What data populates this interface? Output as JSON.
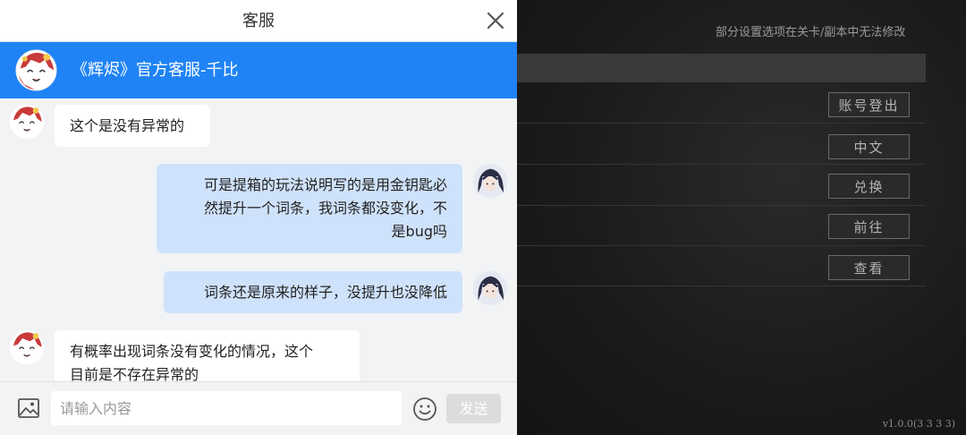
{
  "game": {
    "note": "部分设置选项在关卡/副本中无法修改",
    "buttons": [
      "账号登出",
      "中文",
      "兑换",
      "前往",
      "查看"
    ],
    "version": "v1.0.0(3 3 3 3)"
  },
  "chat": {
    "window_title": "客服",
    "agent_name": "《辉烬》官方客服-千比",
    "messages": [
      {
        "from": "agent",
        "text": "这个是没有异常的"
      },
      {
        "from": "user",
        "lines": [
          "可是提箱的玩法说明写的是用金钥匙必",
          "然提升一个词条，我词条都没变化，不",
          "是bug吗"
        ]
      },
      {
        "from": "user",
        "text": "词条还是原来的样子，没提升也没降低"
      },
      {
        "from": "agent",
        "lines": [
          "有概率出现词条没有变化的情况，这个",
          "目前是不存在异常的"
        ]
      }
    ],
    "input": {
      "placeholder": "请输入内容",
      "value": ""
    },
    "send_label": "发送",
    "colors": {
      "banner": "#1f83f5",
      "user_bubble": "#cfe2fb",
      "agent_bubble": "#ffffff"
    }
  }
}
